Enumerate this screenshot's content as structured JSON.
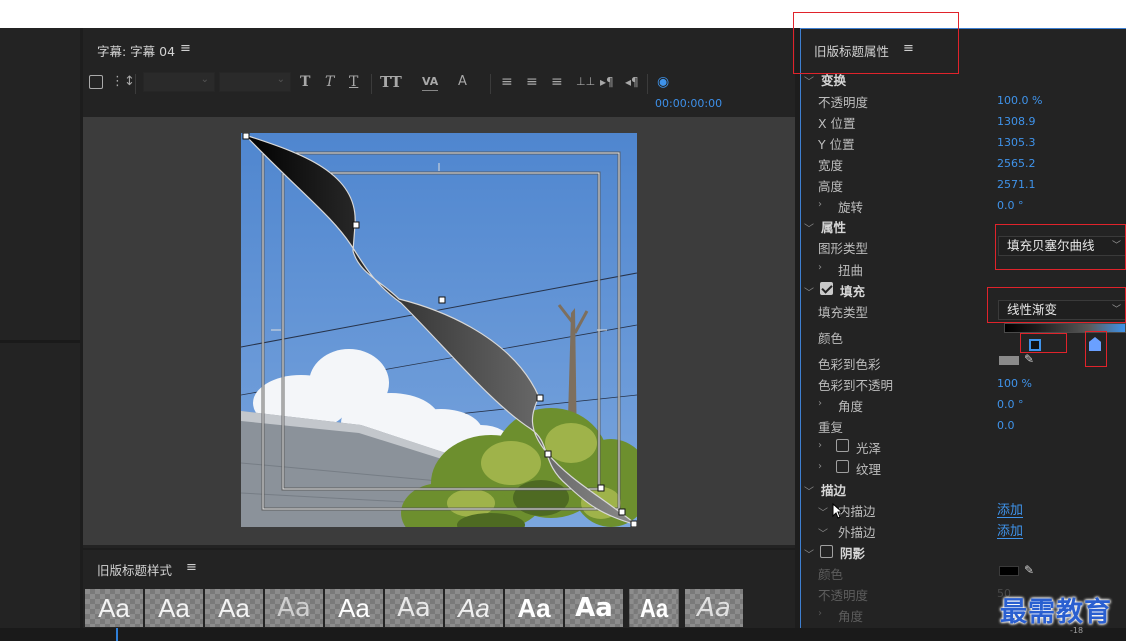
{
  "title_panel": {
    "title": "字幕: 字幕 04",
    "menu_icon": "hamburger-icon",
    "timecode": "00:00:00:00",
    "toolbar_icons": [
      "title-tools-icon",
      "tab-stops-icon",
      "bold-icon",
      "italic-icon",
      "underline-icon",
      "font-size-icon",
      "kerning-icon",
      "leading-icon",
      "align-left-icon",
      "align-center-icon",
      "align-right-icon",
      "tab-stop-icon",
      "ltr-icon",
      "rtl-icon",
      "show-background-video-icon"
    ],
    "toolbar_glyphs": {
      "bold": "T",
      "italic": "T",
      "underline": "T",
      "font_size": "TT",
      "kerning": "VA",
      "leading": "A"
    }
  },
  "styles_panel": {
    "title": "旧版标题样式",
    "swatches": [
      "Aa",
      "Aa",
      "Aa",
      "Aa",
      "Aa",
      "Aa",
      "Aa",
      "Aa",
      "Aa",
      "Aa",
      "Aa"
    ]
  },
  "properties": {
    "title": "旧版标题属性",
    "transform": {
      "label": "变换",
      "opacity_label": "不透明度",
      "opacity": "100.0 %",
      "x_label": "X 位置",
      "x": "1308.9",
      "y_label": "Y 位置",
      "y": "1305.3",
      "width_label": "宽度",
      "width": "2565.2",
      "height_label": "高度",
      "height": "2571.1",
      "rotation_label": "旋转",
      "rotation": "0.0 °"
    },
    "attributes": {
      "label": "属性",
      "graphic_type_label": "图形类型",
      "graphic_type": "填充贝塞尔曲线",
      "distort_label": "扭曲"
    },
    "fill": {
      "label": "填充",
      "checked": true,
      "fill_type_label": "填充类型",
      "fill_type": "线性渐变",
      "color_label": "颜色",
      "color_to_color_label": "色彩到色彩",
      "color_to_opacity_label": "色彩到不透明",
      "color_to_opacity": "100 %",
      "angle_label": "角度",
      "angle": "0.0 °",
      "repeat_label": "重复",
      "repeat": "0.0",
      "sheen_label": "光泽",
      "texture_label": "纹理"
    },
    "stroke": {
      "label": "描边",
      "inner_label": "内描边",
      "inner_action": "添加",
      "outer_label": "外描边",
      "outer_action": "添加"
    },
    "shadow": {
      "label": "阴影",
      "color_label": "颜色",
      "opacity_label": "不透明度",
      "opacity": "50",
      "angle_label": "角度"
    }
  },
  "timeline": {
    "ruler_value": "-18"
  },
  "watermark": "最需教育",
  "colors": {
    "accent": "#3f93ea",
    "highlight_red": "#e0232b",
    "panel_bg": "#232323",
    "sky_blue": "#5f93d4",
    "gradient_start": "#000000",
    "gradient_end": "#8a8a8a"
  }
}
